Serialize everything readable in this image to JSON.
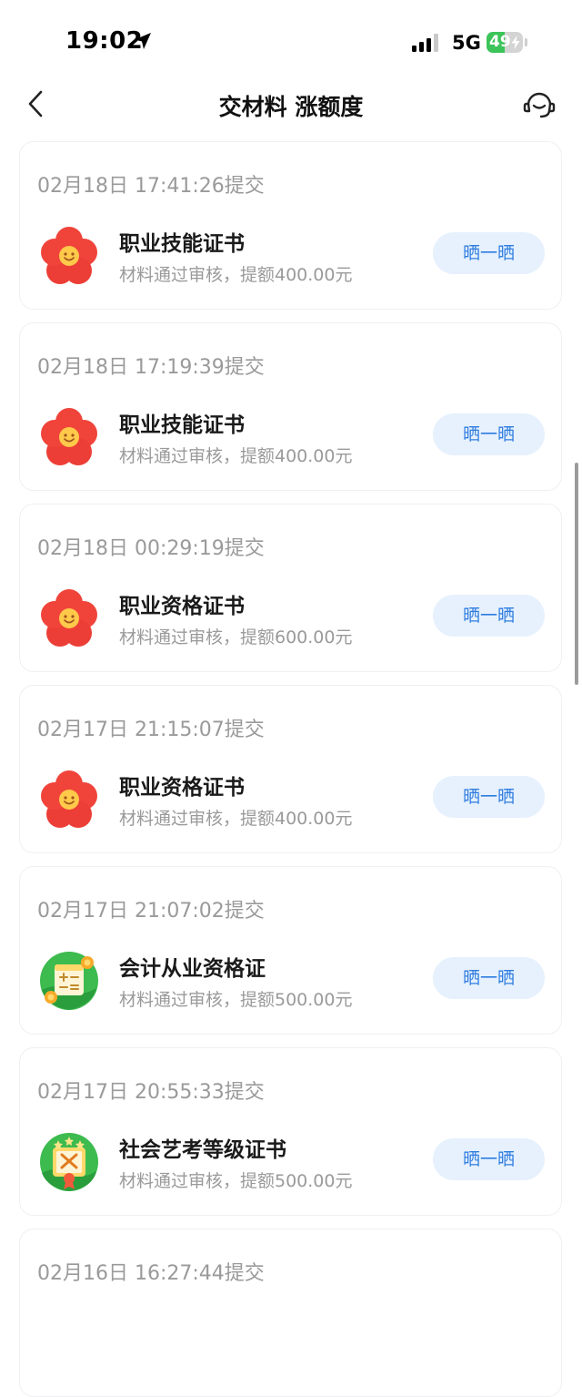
{
  "status_bar": {
    "time": "19:02",
    "network": "5G",
    "battery_level": "49",
    "battery_fraction": 0.49
  },
  "nav": {
    "title": "交材料 涨额度",
    "back_icon": "chevron-left-icon",
    "service_icon": "headset-icon"
  },
  "colors": {
    "accent": "#2f7de0",
    "button_bg": "#e6f1fd",
    "muted_text": "#9a9a9a",
    "battery_green": "#3cc45a"
  },
  "records": [
    {
      "time": "02月18日 17:41:26提交",
      "title": "职业技能证书",
      "desc": "材料通过审核，提额400.00元",
      "button": "晒一晒",
      "icon": "flower-icon"
    },
    {
      "time": "02月18日 17:19:39提交",
      "title": "职业技能证书",
      "desc": "材料通过审核，提额400.00元",
      "button": "晒一晒",
      "icon": "flower-icon"
    },
    {
      "time": "02月18日 00:29:19提交",
      "title": "职业资格证书",
      "desc": "材料通过审核，提额600.00元",
      "button": "晒一晒",
      "icon": "flower-icon"
    },
    {
      "time": "02月17日 21:15:07提交",
      "title": "职业资格证书",
      "desc": "材料通过审核，提额400.00元",
      "button": "晒一晒",
      "icon": "flower-icon"
    },
    {
      "time": "02月17日 21:07:02提交",
      "title": "会计从业资格证",
      "desc": "材料通过审核，提额500.00元",
      "button": "晒一晒",
      "icon": "accounting-certificate-icon"
    },
    {
      "time": "02月17日 20:55:33提交",
      "title": "社会艺考等级证书",
      "desc": "材料通过审核，提额500.00元",
      "button": "晒一晒",
      "icon": "art-exam-certificate-icon"
    },
    {
      "time": "02月16日 16:27:44提交",
      "title": "",
      "desc": "",
      "button": "",
      "icon": ""
    }
  ]
}
